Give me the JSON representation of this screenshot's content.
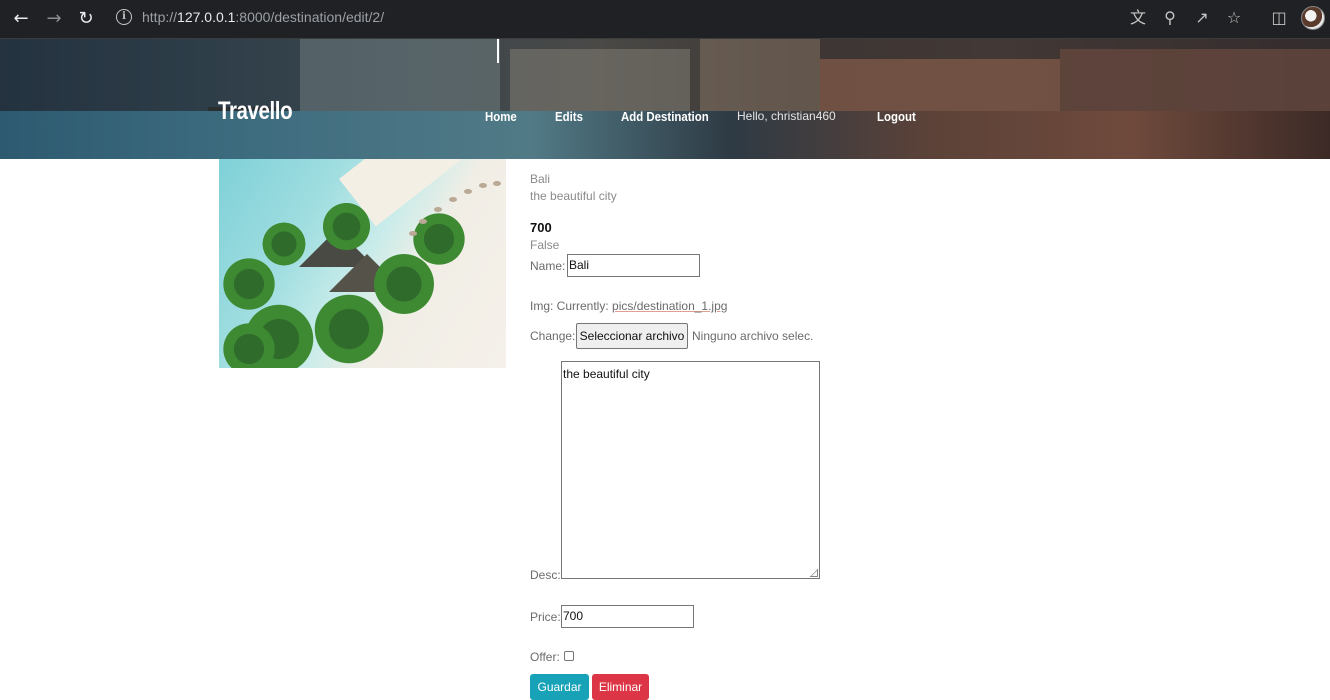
{
  "browser": {
    "url_host": "127.0.0.1",
    "url_prefix": "http://",
    "url_rest": ":8000/destination/edit/2/",
    "icons": [
      "back-icon",
      "forward-icon",
      "reload-icon",
      "info-icon",
      "translate-icon",
      "zoom-icon",
      "share-icon",
      "star-icon",
      "sidepanel-icon",
      "profile-avatar"
    ]
  },
  "site": {
    "logo": "Travello",
    "menu": {
      "home": "Home",
      "edits": "Edits",
      "add_destination": "Add Destination",
      "greeting": "Hello, christian460",
      "logout": "Logout"
    }
  },
  "destination": {
    "name": "Bali",
    "desc": "the beautiful city",
    "price": "700",
    "offer": "False"
  },
  "form": {
    "name_label": "Name:",
    "name_value": "Bali",
    "img_label": "Img: Currently:",
    "img_current": "pics/destination_1.jpg",
    "change_label": "Change:",
    "file_button": "Seleccionar archivo",
    "file_status": "Ninguno archivo selec.",
    "desc_label": "Desc:",
    "desc_value": "the beautiful city",
    "price_label": "Price:",
    "price_value": "700",
    "offer_label": "Offer:",
    "offer_checked": false,
    "save_button": "Guardar",
    "delete_button": "Eliminar"
  },
  "colors": {
    "save": "#17a2b8",
    "delete": "#dc3545"
  }
}
